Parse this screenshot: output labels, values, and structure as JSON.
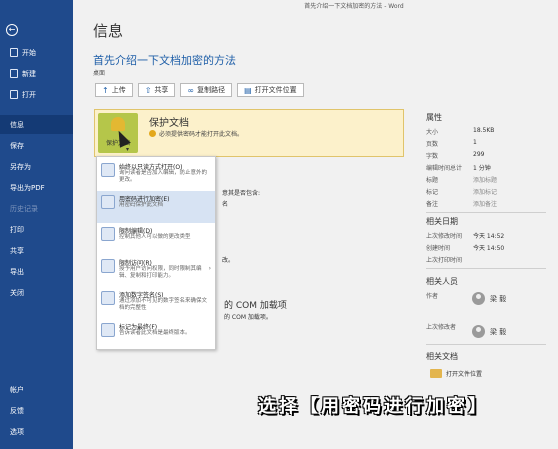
{
  "window": {
    "title": "首先介绍一下文档加密的方法 - Word"
  },
  "sidebar": {
    "back_icon": "←",
    "items": [
      {
        "label": "开始"
      },
      {
        "label": "新建"
      },
      {
        "label": "打开"
      },
      {
        "label": "信息"
      },
      {
        "label": "保存"
      },
      {
        "label": "另存为"
      },
      {
        "label": "导出为PDF"
      },
      {
        "label": "历史记录"
      },
      {
        "label": "打印"
      },
      {
        "label": "共享"
      },
      {
        "label": "导出"
      },
      {
        "label": "关闭"
      }
    ],
    "bottom_items": [
      {
        "label": "帐户"
      },
      {
        "label": "反馈"
      },
      {
        "label": "选项"
      }
    ]
  },
  "header": {
    "title": "信息",
    "doc_title": "首先介绍一下文档加密的方法",
    "location": "桌面"
  },
  "toolbar": {
    "upload": "上传",
    "share": "共享",
    "copy_path": "复制路径",
    "open_location": "打开文件位置"
  },
  "protect": {
    "icon_label": "保护文档",
    "title": "保护文档",
    "desc": "必须提供密码才能打开此文档。"
  },
  "menu": [
    {
      "title": "始终以只读方式打开(O)",
      "desc": "询问读者是否加入编辑，防止意外的更改。"
    },
    {
      "title": "用密码进行加密(E)",
      "desc": "用密码保护此文档"
    },
    {
      "title": "限制编辑(D)",
      "desc": "控制其他人可以做的更改类型"
    },
    {
      "title": "限制访问(R)",
      "desc": "授予用户访问权限，同时限制其编辑、复制和打印能力。",
      "arrow": "›"
    },
    {
      "title": "添加数字签名(S)",
      "desc": "通过添加不可见的数字签名来确保文档的完整性"
    },
    {
      "title": "标记为最终(F)",
      "desc": "告诉读者此文档是最终版本。"
    }
  ],
  "background": {
    "partial1": "意其是否包含:",
    "partial2": "名",
    "partial3": "改。",
    "com_title": "的 COM 加载项",
    "com_desc": "的 COM 加载项。"
  },
  "properties": {
    "title": "属性",
    "rows": [
      {
        "k": "大小",
        "v": "18.5KB"
      },
      {
        "k": "页数",
        "v": "1"
      },
      {
        "k": "字数",
        "v": "299"
      },
      {
        "k": "编辑时间总计",
        "v": "1 分钟"
      },
      {
        "k": "标题",
        "v": "添加标题",
        "placeholder": true
      },
      {
        "k": "标记",
        "v": "添加标记",
        "placeholder": true
      },
      {
        "k": "备注",
        "v": "添加备注",
        "placeholder": true
      }
    ]
  },
  "dates": {
    "title": "相关日期",
    "rows": [
      {
        "k": "上次修改时间",
        "v": "今天 14:52"
      },
      {
        "k": "创建时间",
        "v": "今天 14:50"
      },
      {
        "k": "上次打印时间",
        "v": ""
      }
    ]
  },
  "people": {
    "title": "相关人员",
    "author_label": "作者",
    "author": "梁 毅",
    "modifier_label": "上次修改者",
    "modifier": "梁 毅"
  },
  "docs": {
    "title": "相关文档",
    "open_location": "打开文件位置"
  },
  "caption": "选择【用密码进行加密】"
}
